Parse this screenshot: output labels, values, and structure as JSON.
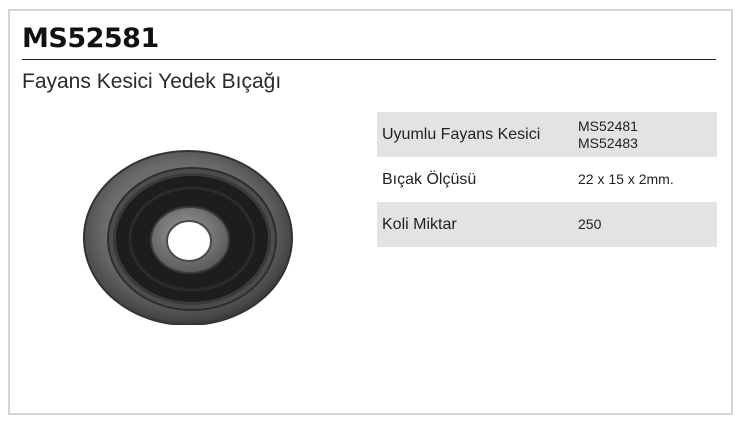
{
  "product": {
    "code": "MS52581",
    "title": "Fayans Kesici Yedek Bıçağı",
    "image": {
      "subject": "tile cutter replacement wheel with bearing",
      "colors": {
        "steel": "#6f6f6f",
        "seal": "#1d1d1d",
        "bore": "#ffffff"
      }
    }
  },
  "specs": [
    {
      "label": "Uyumlu Fayans Kesici",
      "values": [
        "MS52481",
        "MS52483"
      ]
    },
    {
      "label": "Bıçak Ölçüsü",
      "values": [
        "22 x 15 x 2mm."
      ]
    },
    {
      "label": "Koli Miktar",
      "values": [
        "250"
      ]
    }
  ],
  "colors": {
    "row_shade": "#e3e3e3",
    "border": "#d4d4d4",
    "text": "#1a1a1a"
  }
}
